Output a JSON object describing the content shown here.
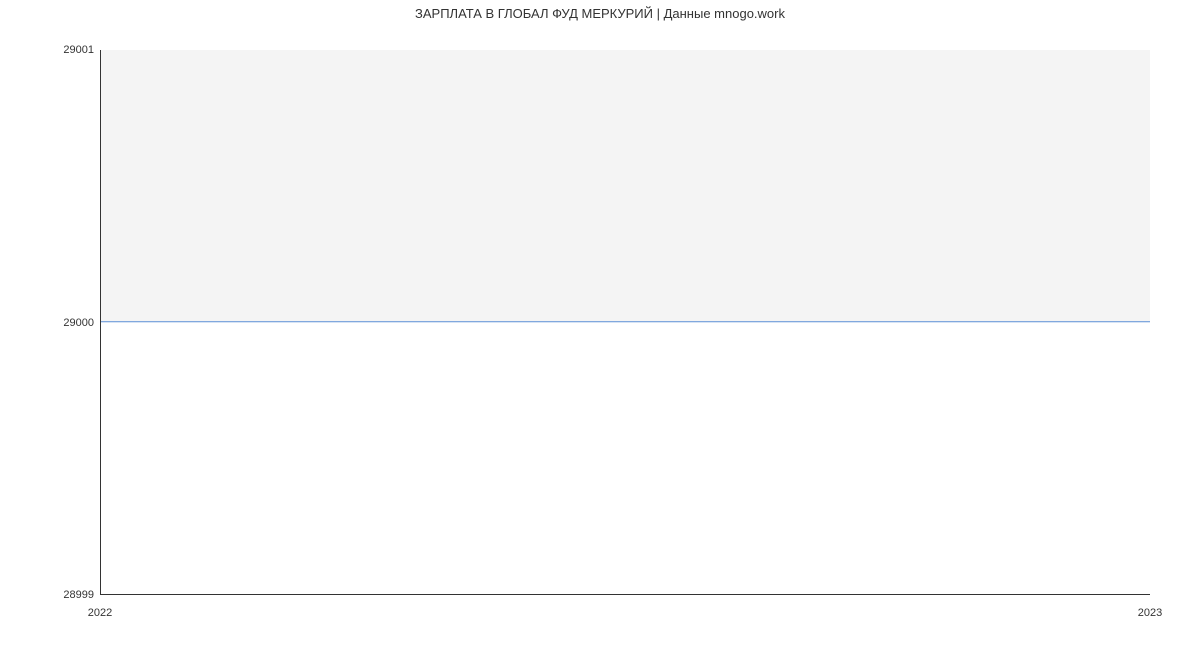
{
  "chart_data": {
    "type": "line",
    "title": "ЗАРПЛАТА В ГЛОБАЛ ФУД МЕРКУРИЙ | Данные mnogo.work",
    "x": [
      2022,
      2023
    ],
    "y": [
      29000,
      29000
    ],
    "xlabel": "",
    "ylabel": "",
    "xlim": [
      2022,
      2023
    ],
    "ylim": [
      28999,
      29001
    ],
    "x_ticks": [
      "2022",
      "2023"
    ],
    "y_ticks": [
      "28999",
      "29000",
      "29001"
    ],
    "line_color": "#5b8fd6",
    "plot_bg": "#f4f4f4"
  }
}
